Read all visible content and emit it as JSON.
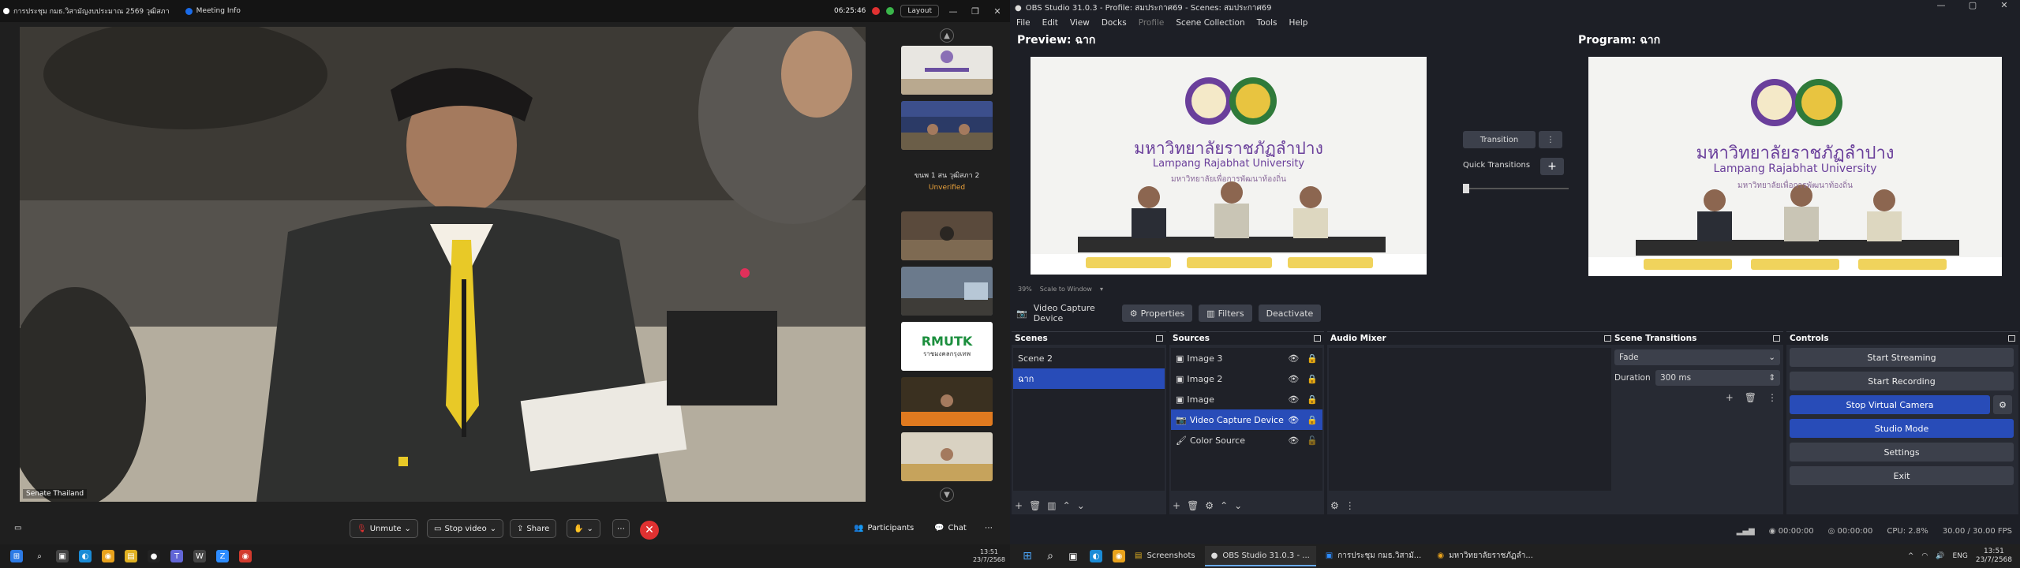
{
  "zoom": {
    "window_title": "การประชุม กมธ.วิสามัญงบประมาณ 2569 วุฒิสภา",
    "meeting_info": "Meeting Info",
    "timer": "06:25:46",
    "layout_label": "Layout",
    "video_label": "Senate Thailand",
    "thumb_text": "ขนพ 1 สน วุฒิสภา 2",
    "thumb_status": "Unverified",
    "thumb_logo": "RMUTK",
    "thumb_logo_sub": "ราชมงคลกรุงเทพ",
    "controls": {
      "unmute": "Unmute",
      "stop_video": "Stop video",
      "share": "Share",
      "participants": "Participants",
      "chat": "Chat"
    }
  },
  "taskbar_left": {
    "time": "13:51",
    "date": "23/7/2568"
  },
  "obs": {
    "title": "OBS Studio 31.0.3 - Profile: สมประกาศ69 - Scenes: สมประกาศ69",
    "menu": [
      "File",
      "Edit",
      "View",
      "Docks",
      "Profile",
      "Scene Collection",
      "Tools",
      "Help"
    ],
    "preview_title": "Preview: ฉาก",
    "program_title": "Program: ฉาก",
    "canvas": {
      "thai_name": "มหาวิทยาลัยราชภัฏลำปาง",
      "eng_name": "Lampang Rajabhat University",
      "slogan": "มหาวิทยาลัยเพื่อการพัฒนาท้องถิ่น"
    },
    "zoom_pct": "39%",
    "scale_label": "Scale to Window",
    "transition_btn": "Transition",
    "quick_transitions": "Quick Transitions",
    "source_name": "Video Capture Device",
    "source_buttons": {
      "properties": "Properties",
      "filters": "Filters",
      "deactivate": "Deactivate"
    },
    "docks": {
      "scenes": "Scenes",
      "sources": "Sources",
      "audio_mixer": "Audio Mixer",
      "scene_transitions": "Scene Transitions",
      "controls": "Controls"
    },
    "scenes": [
      "Scene 2",
      "ฉาก"
    ],
    "sources": [
      "Image 3",
      "Image 2",
      "Image",
      "Video Capture Device",
      "Color Source"
    ],
    "transition": {
      "type": "Fade",
      "duration_label": "Duration",
      "duration_value": "300 ms"
    },
    "controls": {
      "start_streaming": "Start Streaming",
      "start_recording": "Start Recording",
      "stop_virtual_camera": "Stop Virtual Camera",
      "studio_mode": "Studio Mode",
      "settings": "Settings",
      "exit": "Exit"
    },
    "status": {
      "stream_time": "00:00:00",
      "rec_time": "00:00:00",
      "cpu": "CPU: 2.8%",
      "fps": "30.00 / 30.00 FPS"
    }
  },
  "taskbar_right": {
    "apps": [
      "Screenshots",
      "OBS Studio 31.0.3 - ...",
      "การประชุม กมธ.วิสามั...",
      "มหาวิทยาลัยราชภัฏลำ..."
    ],
    "lang": "ENG",
    "time": "13:51",
    "date": "23/7/2568"
  },
  "colors": {
    "obs_blue": "#284cb8",
    "end_call": "#e03131",
    "zoom_bg": "#1f1f1f"
  }
}
